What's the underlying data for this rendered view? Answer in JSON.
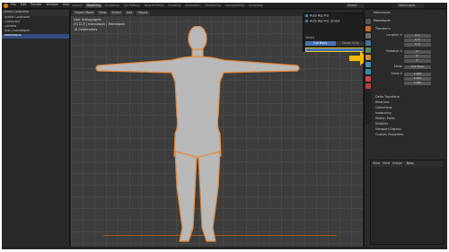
{
  "menu": [
    "File",
    "Edit",
    "Render",
    "Window",
    "Help"
  ],
  "workspaces": [
    "Layout",
    "Modeling",
    "Sculpting",
    "UV Editing",
    "Texture Paint",
    "Shading",
    "Animation",
    "Rendering",
    "Compositing",
    "Scripting"
  ],
  "active_workspace": "Modeling",
  "scene_field": "Scene",
  "view_layer_field": "View Layer",
  "outliner": {
    "header": "Scene Collection",
    "rows": [
      {
        "label": "Scene Collection",
        "selected": false
      },
      {
        "label": "Collection",
        "selected": false
      },
      {
        "label": "Camera",
        "selected": false
      },
      {
        "label": "man_mannequin",
        "selected": false
      },
      {
        "label": "Mannequin",
        "selected": true
      }
    ]
  },
  "viewport": {
    "header_buttons": [
      "Object Mode",
      "View",
      "Select",
      "Add",
      "Object"
    ],
    "info_lines": [
      "User Orthographic",
      "(0) CC3 | mannequin | Mannequin",
      "10 Centimeters"
    ]
  },
  "popover": {
    "items": [
      "Auto Rig Pro",
      "Auto Rig Pro: Smart"
    ],
    "reset_label": "Smart",
    "mode_buttons": [
      "Full Body",
      "Facial Only"
    ],
    "slider_label": ""
  },
  "properties": {
    "header": "Mannequin",
    "object_name": "Mannequin",
    "transform_label": "Transform",
    "location_label": "Location X",
    "rotation_label": "Rotation X",
    "scale_label": "Scale X",
    "mode_label": "Mode",
    "mode_value": "XYZ Euler",
    "loc": [
      "0 m",
      "0 m",
      "0 m"
    ],
    "rot": [
      "0°",
      "0°",
      "0°"
    ],
    "scale": [
      "1.000",
      "1.000",
      "1.000"
    ],
    "sections": [
      "Delta Transform",
      "Relations",
      "Collections",
      "Instancing",
      "Motion Paths",
      "Visibility",
      "Viewport Display",
      "Custom Properties"
    ]
  },
  "preview": {
    "header_items": [
      "View",
      "View",
      "Image"
    ],
    "new_label": "New"
  },
  "colors": {
    "accent_blue": "#4772b3",
    "selection_orange": "#e5883a",
    "arrow_yellow": "#f5b800"
  }
}
